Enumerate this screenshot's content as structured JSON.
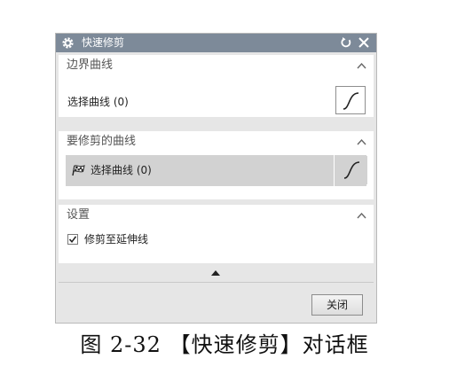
{
  "dialog": {
    "title": "快速修剪",
    "title_icon": "gear-icon",
    "reset_icon": "reset-icon",
    "close_icon": "close-icon"
  },
  "groups": [
    {
      "header": "边界曲线",
      "row_label": "选择曲线 (0)"
    },
    {
      "header": "要修剪的曲线",
      "row_label": "选择曲线 (0)"
    },
    {
      "header": "设置",
      "checkbox_label": "修剪至延伸线",
      "checkbox_checked": true
    }
  ],
  "footer": {
    "close_button": "关闭"
  },
  "caption": "图 2-32 【快速修剪】对话框",
  "colors": {
    "titlebar": "#7d8a99",
    "dialog_bg": "#e6e6e6",
    "selected_row": "#d2d2d2"
  }
}
